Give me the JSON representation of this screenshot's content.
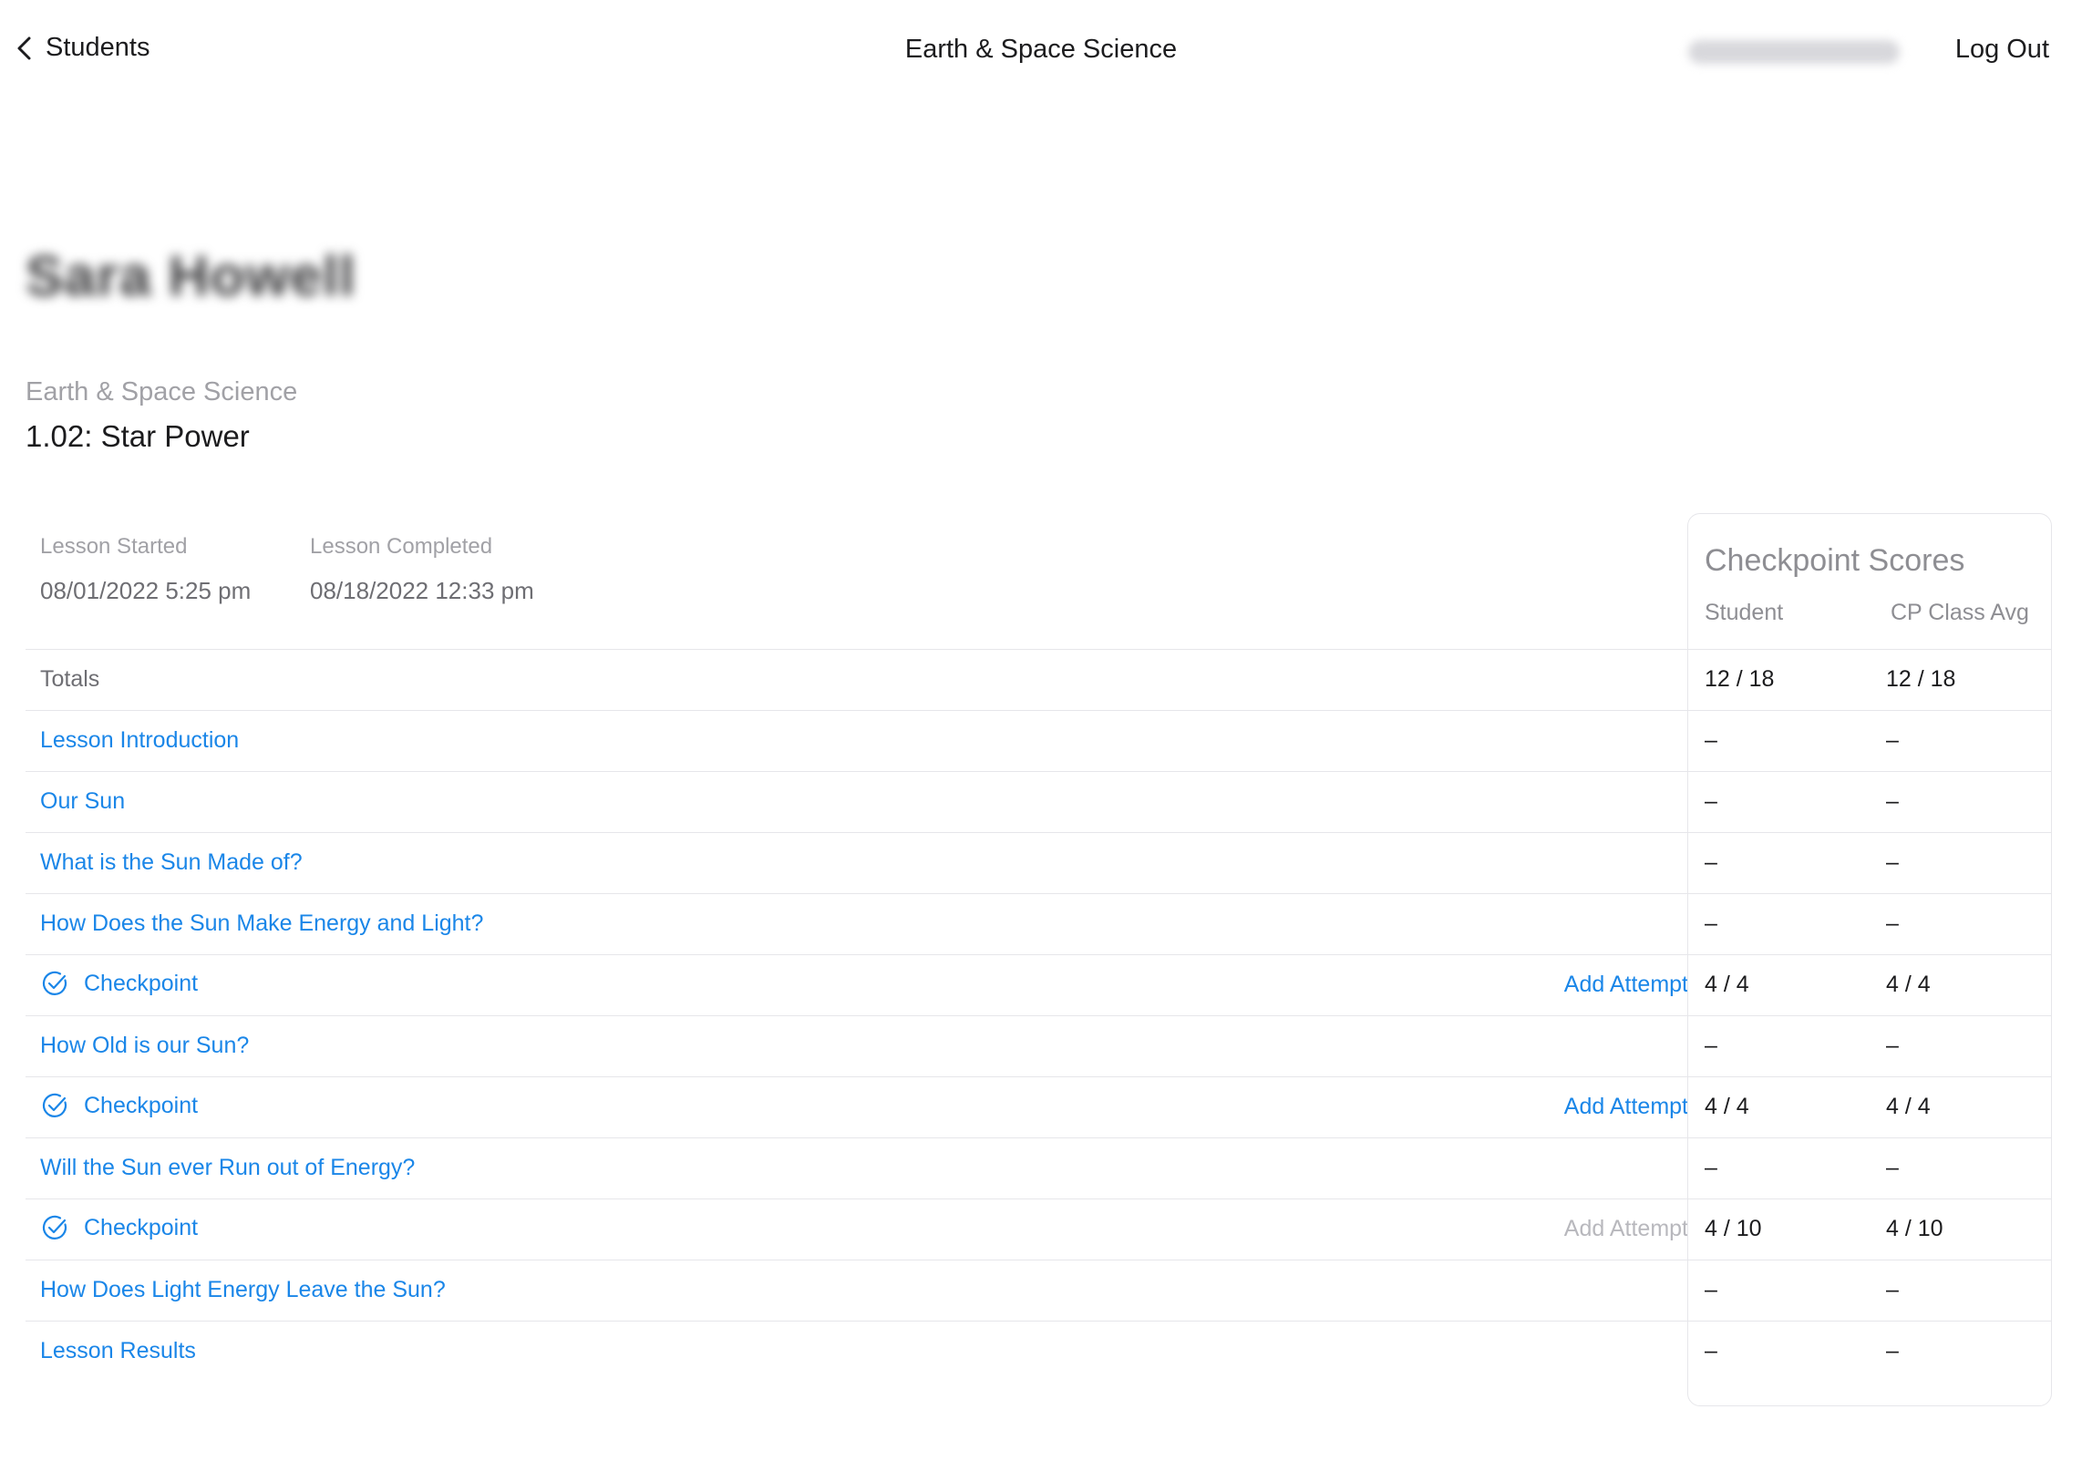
{
  "header": {
    "back_label": "Students",
    "title": "Earth & Space Science",
    "logout_label": "Log Out"
  },
  "student": {
    "name_display": "Sara Howell"
  },
  "lesson": {
    "course": "Earth & Space Science",
    "title": "1.02: Star Power",
    "started_label": "Lesson Started",
    "started_value": "08/01/2022 5:25 pm",
    "completed_label": "Lesson Completed",
    "completed_value": "08/18/2022 12:33 pm"
  },
  "checkpoint_panel": {
    "title": "Checkpoint Scores",
    "col_student": "Student",
    "col_class_avg": "CP Class Avg"
  },
  "rows": [
    {
      "label": "Totals",
      "student": "12 / 18",
      "avg": "12 / 18"
    },
    {
      "label": "Lesson Introduction",
      "student": "–",
      "avg": "–"
    },
    {
      "label": "Our Sun",
      "student": "–",
      "avg": "–"
    },
    {
      "label": "What is the Sun Made of?",
      "student": "–",
      "avg": "–"
    },
    {
      "label": "How Does the Sun Make Energy and Light?",
      "student": "–",
      "avg": "–"
    },
    {
      "label": "Checkpoint",
      "attempt": "Add Attempt",
      "student": "4 / 4",
      "avg": "4 / 4"
    },
    {
      "label": "How Old is our Sun?",
      "student": "–",
      "avg": "–"
    },
    {
      "label": "Checkpoint",
      "attempt": "Add Attempt",
      "student": "4 / 4",
      "avg": "4 / 4"
    },
    {
      "label": "Will the Sun ever Run out of Energy?",
      "student": "–",
      "avg": "–"
    },
    {
      "label": "Checkpoint",
      "attempt": "Add Attempt",
      "student": "4 / 10",
      "avg": "4 / 10"
    },
    {
      "label": "How Does Light Energy Leave the Sun?",
      "student": "–",
      "avg": "–"
    },
    {
      "label": "Lesson Results",
      "student": "–",
      "avg": "–"
    }
  ],
  "colors": {
    "link": "#1a86e8",
    "muted": "#a1a1a6",
    "divider": "#e6e6ea",
    "disabled": "#b8b8bd"
  },
  "icons": {
    "back": "chevron-left-icon",
    "checkpoint": "check-circle-icon"
  }
}
